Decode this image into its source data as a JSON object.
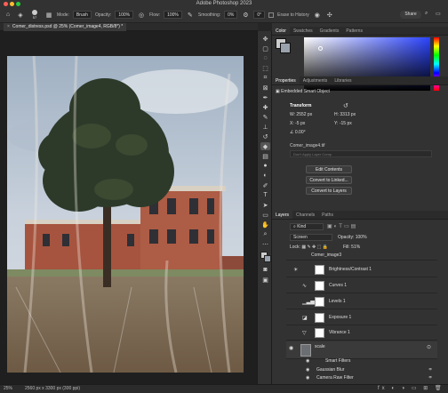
{
  "app": {
    "title": "Adobe Photoshop 2023"
  },
  "options": {
    "brush_size": "57",
    "mode_label": "Mode:",
    "mode_value": "Brush",
    "opacity_label": "Opacity:",
    "opacity_value": "100%",
    "flow_label": "Flow:",
    "flow_value": "100%",
    "smoothing_label": "Smoothing:",
    "smoothing_value": "0%",
    "angle_value": "0°",
    "erase_history_label": "Erase to History",
    "share_label": "Share"
  },
  "document": {
    "tab_label": "Comer_distress.psd @ 25% (Comer_image4, RGB/8*) *"
  },
  "color_panel": {
    "tabs": [
      "Color",
      "Swatches",
      "Gradients",
      "Patterns"
    ]
  },
  "properties": {
    "tabs": [
      "Properties",
      "Adjustments",
      "Libraries"
    ],
    "object_type": "Embedded Smart Object",
    "transform_label": "Transform",
    "w_label": "W:",
    "w_value": "2552 px",
    "h_label": "H:",
    "h_value": "3313 px",
    "x_label": "X:",
    "x_value": "-5 px",
    "y_label": "Y:",
    "y_value": "-15 px",
    "angle_value": "0.00°",
    "file_name": "Comer_image4.tif",
    "link_placeholder": "Don't Apply Layer Comp",
    "edit_contents": "Edit Contents",
    "convert_linked": "Convert to Linked...",
    "convert_layers": "Convert to Layers"
  },
  "layers_panel": {
    "tabs": [
      "Layers",
      "Channels",
      "Paths"
    ],
    "filter_kind": "Kind",
    "blend_mode": "Screen",
    "opacity_label": "Opacity:",
    "opacity_value": "100%",
    "lock_label": "Lock:",
    "fill_label": "Fill:",
    "fill_value": "51%",
    "layers": [
      {
        "name": "Comer_image3"
      },
      {
        "name": "Brightness/Contrast 1"
      },
      {
        "name": "Curves 1"
      },
      {
        "name": "Levels 1"
      },
      {
        "name": "Exposure 1"
      },
      {
        "name": "Vibrance 1"
      },
      {
        "name": "scale"
      },
      {
        "name": "Smart Filters"
      },
      {
        "name": "Gaussian Blur"
      },
      {
        "name": "Camera Raw Filter"
      }
    ]
  },
  "status": {
    "zoom": "25%",
    "doc_size": "2560 px x 3300 px (300 ppi)"
  },
  "colors": {
    "accent": "#2d8ceb",
    "panel": "#323232",
    "background": "#1f1f1f"
  }
}
